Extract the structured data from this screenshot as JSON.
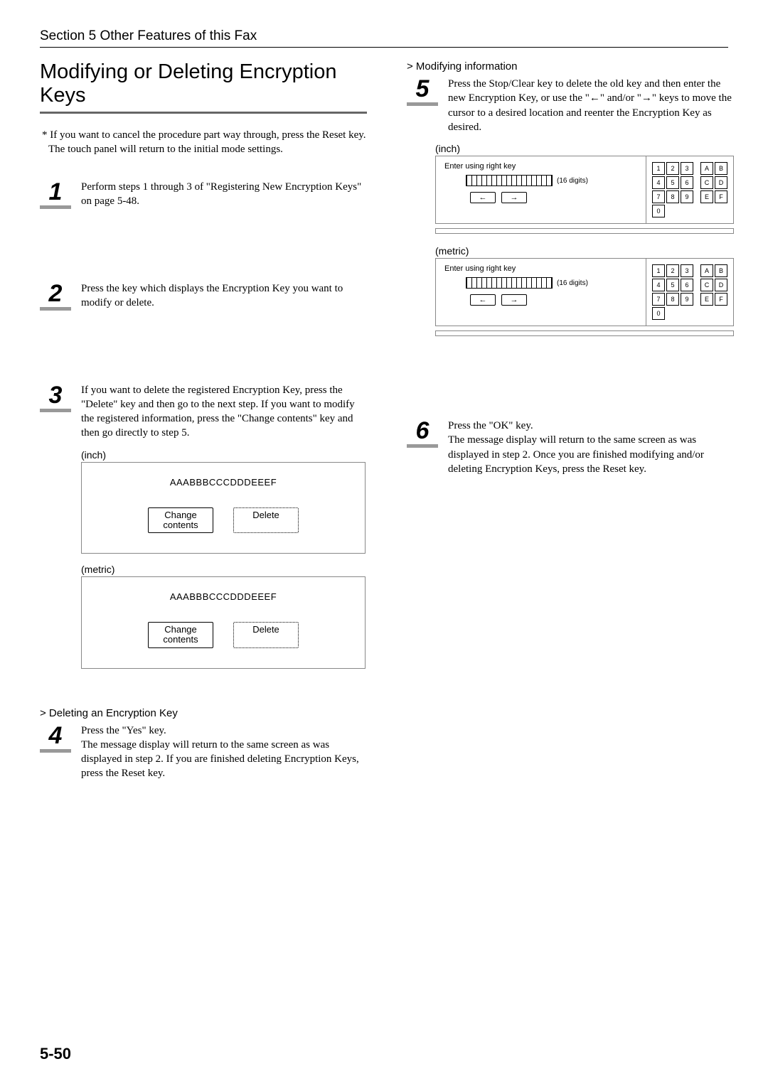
{
  "header": {
    "section": "Section 5  Other Features of this Fax"
  },
  "title": "Modifying or Deleting Encryption Keys",
  "left": {
    "note": "* If you want to cancel the procedure part way through, press the Reset key. The touch panel will return to the initial mode settings.",
    "step1": "Perform steps 1 through 3 of \"Registering New Encryption Keys\" on page 5-48.",
    "step2": "Press the key which displays the Encryption Key you want to modify or delete.",
    "step3": "If you want to delete the registered Encryption Key, press the \"Delete\" key and then go to the next step. If you want to modify the registered information, press the \"Change contents\" key and then go directly to step 5.",
    "unit_inch": "(inch)",
    "unit_metric": "(metric)",
    "panel_code": "AAABBBCCCDDDEEEF",
    "btn_change": "Change\ncontents",
    "btn_delete": "Delete",
    "del_head": "> Deleting an Encryption Key",
    "step4": "Press the \"Yes\" key.\nThe message display will return to the same screen as was displayed in step 2. If you are finished deleting Encryption Keys, press the Reset key."
  },
  "right": {
    "mod_head": "> Modifying information",
    "step5": "Press the Stop/Clear key to delete the old key and then enter the new Encryption Key, or use the \"←\" and/or \"→\" keys to move the cursor to a desired location and reenter the Encryption Key as desired.",
    "unit_inch": "(inch)",
    "unit_metric": "(metric)",
    "prompt": "Enter using right key",
    "digits": "(16 digits)",
    "keys": [
      "1",
      "2",
      "3",
      "A",
      "B",
      "4",
      "5",
      "6",
      "C",
      "D",
      "7",
      "8",
      "9",
      "E",
      "F",
      "0"
    ],
    "step6": "Press the \"OK\" key.\nThe message display will return to the same screen as was displayed in step 2. Once you are finished modifying and/or deleting Encryption Keys, press the Reset key."
  },
  "nums": {
    "1": "1",
    "2": "2",
    "3": "3",
    "4": "4",
    "5": "5",
    "6": "6"
  },
  "page_num": "5-50"
}
